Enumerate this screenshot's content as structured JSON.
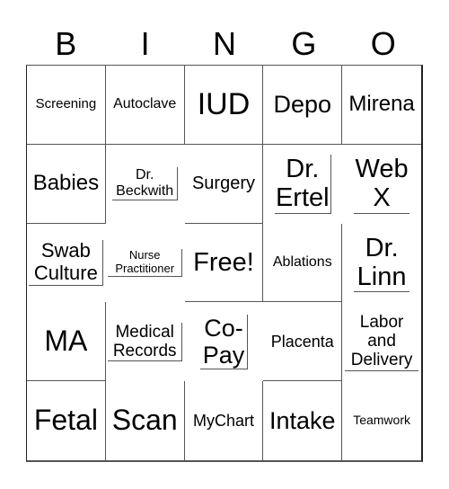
{
  "header": [
    "B",
    "I",
    "N",
    "G",
    "O"
  ],
  "cells": [
    "Screening",
    "Autoclave",
    "IUD",
    "Depo",
    "Mirena",
    "Babies",
    "Dr. Beckwith",
    "Surgery",
    "Dr. Ertel",
    "Web X",
    "Swab Culture",
    "Nurse Practitioner",
    "Free!",
    "Ablations",
    "Dr. Linn",
    "MA",
    "Medical Records",
    "Co-Pay",
    "Placenta",
    "Labor and Delivery",
    "Fetal",
    "Scan",
    "MyChart",
    "Intake",
    "Teamwork"
  ]
}
